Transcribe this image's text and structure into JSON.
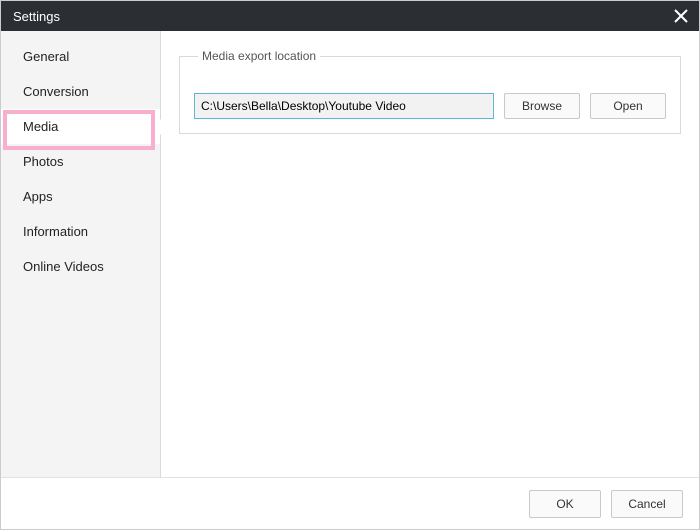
{
  "window": {
    "title": "Settings"
  },
  "sidebar": {
    "items": [
      {
        "label": "General"
      },
      {
        "label": "Conversion"
      },
      {
        "label": "Media"
      },
      {
        "label": "Photos"
      },
      {
        "label": "Apps"
      },
      {
        "label": "Information"
      },
      {
        "label": "Online Videos"
      }
    ],
    "selected_index": 2
  },
  "content": {
    "group_title": "Media export location",
    "path_value": "C:\\Users\\Bella\\Desktop\\Youtube Video",
    "browse_label": "Browse",
    "open_label": "Open"
  },
  "footer": {
    "ok_label": "OK",
    "cancel_label": "Cancel"
  }
}
